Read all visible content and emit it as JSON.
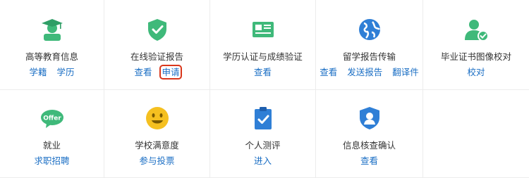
{
  "colors": {
    "green": "#3fb97a",
    "blue": "#1a6ec4",
    "yellow": "#f5c020",
    "red_highlight": "#d9361b"
  },
  "tiles": {
    "higher_ed": {
      "title": "高等教育信息",
      "links": [
        "学籍",
        "学历"
      ],
      "icon": "graduate-icon"
    },
    "online_report": {
      "title": "在线验证报告",
      "links": [
        "查看",
        "申请"
      ],
      "icon": "shield-check-icon"
    },
    "transcript": {
      "title": "学历认证与成绩验证",
      "links": [
        "查看"
      ],
      "icon": "id-card-icon"
    },
    "study_abroad": {
      "title": "留学报告传输",
      "links": [
        "查看",
        "发送报告",
        "翻译件"
      ],
      "icon": "globe-icon"
    },
    "diploma_image": {
      "title": "毕业证书图像校对",
      "links": [
        "校对"
      ],
      "icon": "user-check-icon"
    },
    "employment": {
      "title": "就业",
      "links": [
        "求职招聘"
      ],
      "icon": "offer-icon",
      "badge": "Offer"
    },
    "school_satisfaction": {
      "title": "学校满意度",
      "links": [
        "参与投票"
      ],
      "icon": "smile-icon"
    },
    "personal_test": {
      "title": "个人测评",
      "links": [
        "进入"
      ],
      "icon": "clipboard-check-icon"
    },
    "info_verify": {
      "title": "信息核查确认",
      "links": [
        "查看"
      ],
      "icon": "user-shield-icon"
    }
  }
}
